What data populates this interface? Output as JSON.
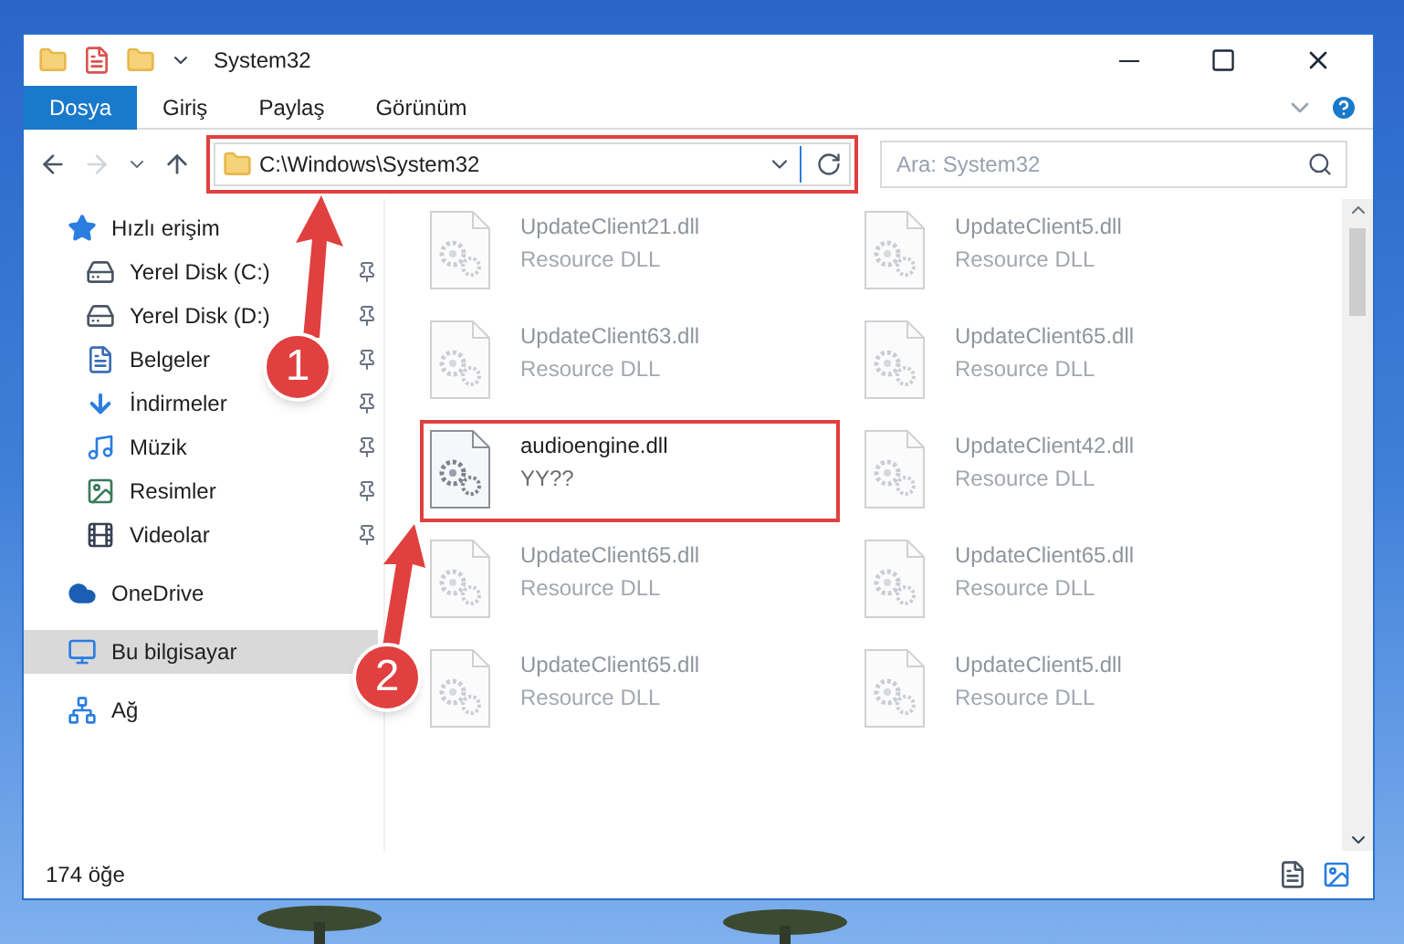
{
  "window": {
    "title": "System32"
  },
  "ribbon_tabs": [
    {
      "label": "Dosya",
      "selected": true
    },
    {
      "label": "Giriş",
      "selected": false
    },
    {
      "label": "Paylaş",
      "selected": false
    },
    {
      "label": "Görünüm",
      "selected": false
    }
  ],
  "address": {
    "value": "C:\\Windows\\System32",
    "highlighted": true
  },
  "search": {
    "placeholder": "Ara: System32"
  },
  "nav": [
    {
      "label": "Hızlı erişim",
      "kind": "star",
      "selected": false,
      "children": [
        {
          "label": "Yerel Disk (C:)",
          "kind": "drive",
          "pinned": true,
          "selected": false
        },
        {
          "label": "Yerel Disk (D:)",
          "kind": "drive",
          "pinned": true,
          "selected": false
        },
        {
          "label": "Belgeler",
          "kind": "documents",
          "pinned": true,
          "selected": false
        },
        {
          "label": "İndirmeler",
          "kind": "downloads",
          "pinned": true,
          "selected": false
        },
        {
          "label": "Müzik",
          "kind": "music",
          "pinned": true,
          "selected": false
        },
        {
          "label": "Resimler",
          "kind": "pictures",
          "pinned": true,
          "selected": false
        },
        {
          "label": "Videolar",
          "kind": "videos",
          "pinned": true,
          "selected": false
        }
      ]
    },
    {
      "label": "OneDrive",
      "kind": "cloud",
      "selected": false
    },
    {
      "label": "Bu bilgisayar",
      "kind": "computer",
      "selected": true
    },
    {
      "label": "Ağ",
      "kind": "network",
      "selected": false
    }
  ],
  "files": [
    {
      "name": "UpdateClient21.dll",
      "type": "Resource DLL",
      "blurred": true,
      "highlighted": false
    },
    {
      "name": "UpdateClient5.dll",
      "type": "Resource DLL",
      "blurred": true,
      "highlighted": false
    },
    {
      "name": "UpdateClient63.dll",
      "type": "Resource DLL",
      "blurred": true,
      "highlighted": false
    },
    {
      "name": "UpdateClient65.dll",
      "type": "Resource DLL",
      "blurred": true,
      "highlighted": false
    },
    {
      "name": "audioengine.dll",
      "type": "YY??",
      "blurred": false,
      "highlighted": true
    },
    {
      "name": "UpdateClient42.dll",
      "type": "Resource DLL",
      "blurred": true,
      "highlighted": false
    },
    {
      "name": "UpdateClient65.dll",
      "type": "Resource DLL",
      "blurred": true,
      "highlighted": false
    },
    {
      "name": "UpdateClient65.dll",
      "type": "Resource DLL",
      "blurred": true,
      "highlighted": false
    },
    {
      "name": "UpdateClient65.dll",
      "type": "Resource DLL",
      "blurred": true,
      "highlighted": false
    },
    {
      "name": "UpdateClient5.dll",
      "type": "Resource DLL",
      "blurred": true,
      "highlighted": false
    }
  ],
  "status_bar": {
    "count": "174 öğe"
  },
  "annotations": [
    {
      "label": "1"
    },
    {
      "label": "2"
    }
  ]
}
